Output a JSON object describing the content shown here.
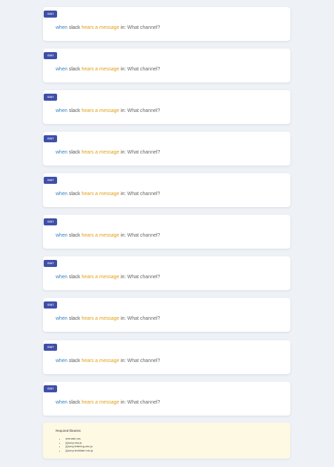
{
  "steps": [
    {
      "badge": "start",
      "when": "when",
      "service": "slack",
      "event": "hears a message",
      "in": "in:",
      "question": "What channel?"
    },
    {
      "badge": "start",
      "when": "when",
      "service": "slack",
      "event": "hears a message",
      "in": "in:",
      "question": "What channel?"
    },
    {
      "badge": "start",
      "when": "when",
      "service": "slack",
      "event": "hears a message",
      "in": "in:",
      "question": "What channel?"
    },
    {
      "badge": "start",
      "when": "when",
      "service": "slack",
      "event": "hears a message",
      "in": "in:",
      "question": "What channel?"
    },
    {
      "badge": "start",
      "when": "when",
      "service": "slack",
      "event": "hears a message",
      "in": "in:",
      "question": "What channel?"
    },
    {
      "badge": "start",
      "when": "when",
      "service": "slack",
      "event": "hears a message",
      "in": "in:",
      "question": "What channel?"
    },
    {
      "badge": "start",
      "when": "when",
      "service": "slack",
      "event": "hears a message",
      "in": "in:",
      "question": "What channel?"
    },
    {
      "badge": "start",
      "when": "when",
      "service": "slack",
      "event": "hears a message",
      "in": "in:",
      "question": "What channel?"
    },
    {
      "badge": "start",
      "when": "when",
      "service": "slack",
      "event": "hears a message",
      "in": "in:",
      "question": "What channel?"
    },
    {
      "badge": "start",
      "when": "when",
      "service": "slack",
      "event": "hears a message",
      "in": "in:",
      "question": "What channel?"
    }
  ],
  "notice": {
    "title": "Required libraries:",
    "libraries": [
      "animate.css",
      "jQuery.min.js",
      "jQuery.lettering.min.js",
      "jQuery.textillate.min.js"
    ]
  },
  "colors": {
    "badge": "#3f4fa8",
    "when": "#2f7fbf",
    "event": "#e1a016",
    "notice_bg": "#fdf9e3",
    "page_bg": "#eef1f6"
  }
}
